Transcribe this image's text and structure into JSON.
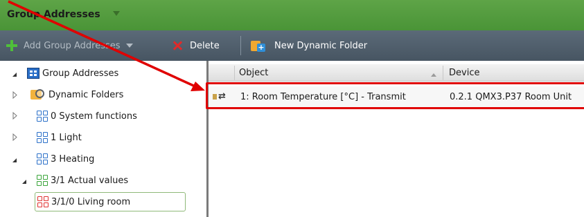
{
  "header": {
    "title": "Group Addresses"
  },
  "toolbar": {
    "add_label": "Add Group Addresses",
    "delete_label": "Delete",
    "new_dynamic_folder_label": "New Dynamic Folder"
  },
  "tree": {
    "root_label": "Group Addresses",
    "items": [
      {
        "label": "Dynamic Folders"
      },
      {
        "label": "0 System functions"
      },
      {
        "label": "1 Light"
      },
      {
        "label": "3 Heating"
      },
      {
        "label": "3/1 Actual values"
      },
      {
        "label": "3/1/0 Living room"
      }
    ]
  },
  "table": {
    "columns": [
      "Object",
      "Device"
    ],
    "rows": [
      {
        "object": "1: Room Temperature [°C] - Transmit",
        "device": "0.2.1  QMX3.P37 Room Unit"
      }
    ]
  },
  "colors": {
    "titlebar": "#55a040",
    "toolbar": "#505e6b",
    "highlight": "#e00000",
    "icon_blue": "#2a6fc8",
    "icon_green": "#3aa53a",
    "icon_red": "#e03030"
  },
  "icons": [
    "plus-icon",
    "close-icon",
    "new-dynamic-folder-icon",
    "group-address-icon",
    "dynamic-folder-icon",
    "transmit-icon"
  ]
}
